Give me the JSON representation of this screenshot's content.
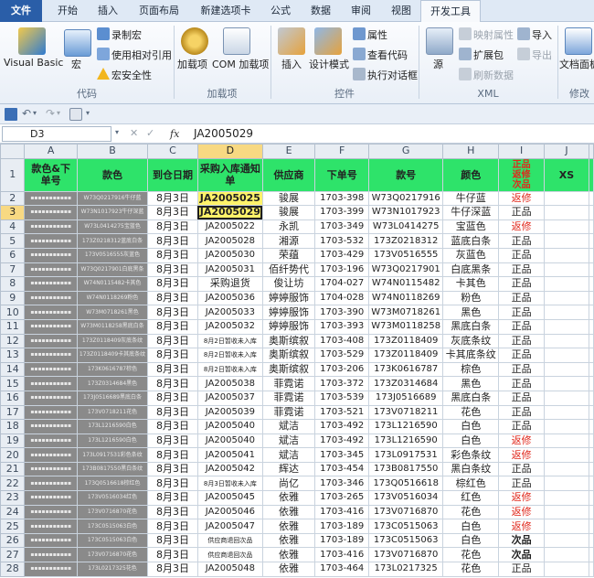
{
  "tabs": [
    "文件",
    "开始",
    "插入",
    "页面布局",
    "新建选项卡",
    "公式",
    "数据",
    "审阅",
    "视图",
    "开发工具"
  ],
  "ribbon": {
    "code": {
      "visual_basic": "Visual Basic",
      "macro": "宏",
      "record_macro": "录制宏",
      "relative_ref": "使用相对引用",
      "macro_security": "宏安全性",
      "label": "代码"
    },
    "addins": {
      "addins": "加载项",
      "com_addins": "COM 加载项",
      "label": "加载项"
    },
    "controls": {
      "insert": "插入",
      "design_mode": "设计模式",
      "properties": "属性",
      "view_code": "查看代码",
      "run_dialog": "执行对话框",
      "label": "控件"
    },
    "xml": {
      "source": "源",
      "map_props": "映射属性",
      "expansion_packs": "扩展包",
      "refresh_data": "刷新数据",
      "import": "导入",
      "export": "导出",
      "label": "XML"
    },
    "modify": {
      "doc_panel": "文档面板",
      "label": "修改"
    }
  },
  "formula_bar": {
    "name_box": "D3",
    "fx": "fx",
    "value": "JA2005029"
  },
  "colors": {
    "header_fill": "#2ee36a",
    "red_text": "#e0281c",
    "file_tab": "#2a5ea8",
    "selection_header": "#f8d982"
  },
  "sheet": {
    "columns": [
      "A",
      "B",
      "C",
      "D",
      "E",
      "F",
      "G",
      "H",
      "I",
      "J"
    ],
    "header": [
      "款色&下单号",
      "款色",
      "到仓日期",
      "采购入库通知单",
      "供应商",
      "下单号",
      "款号",
      "颜色",
      "正品 返修 次品",
      "XS"
    ],
    "rows": [
      [
        "2",
        "▪▪▪▪▪▪▪▪▪▪▪",
        "W73Q0217916牛仔蓝",
        "8月3日",
        "JA2005025",
        "骏展",
        "1703-398",
        "W73Q0217916",
        "牛仔蓝",
        "返修"
      ],
      [
        "3",
        "▪▪▪▪▪▪▪▪▪▪▪",
        "W73N1017923牛仔深蓝",
        "8月3日",
        "JA2005029",
        "骏展",
        "1703-399",
        "W73N1017923",
        "牛仔深蓝",
        "正品"
      ],
      [
        "4",
        "▪▪▪▪▪▪▪▪▪▪▪",
        "W73L0414275宝蓝色",
        "8月3日",
        "JA2005022",
        "永凯",
        "1703-349",
        "W73L0414275",
        "宝蓝色",
        "返修"
      ],
      [
        "5",
        "▪▪▪▪▪▪▪▪▪▪▪",
        "173Z0218312蓝底白条",
        "8月3日",
        "JA2005028",
        "湘源",
        "1703-532",
        "173Z0218312",
        "蓝底白条",
        "正品"
      ],
      [
        "6",
        "▪▪▪▪▪▪▪▪▪▪▪",
        "173V0516555灰蓝色",
        "8月3日",
        "JA2005030",
        "荣蕴",
        "1703-429",
        "173V0516555",
        "灰蓝色",
        "正品"
      ],
      [
        "7",
        "▪▪▪▪▪▪▪▪▪▪▪",
        "W73Q0217901白底黑条",
        "8月3日",
        "JA2005031",
        "佰纤势代",
        "1703-196",
        "W73Q0217901",
        "白底黑条",
        "正品"
      ],
      [
        "8",
        "▪▪▪▪▪▪▪▪▪▪▪",
        "W74N0115482卡其色",
        "8月3日",
        "采购退货",
        "俊让坊",
        "1704-027",
        "W74N0115482",
        "卡其色",
        "正品"
      ],
      [
        "9",
        "▪▪▪▪▪▪▪▪▪▪▪",
        "W74N0118269粉色",
        "8月3日",
        "JA2005036",
        "婷婷服饰",
        "1704-028",
        "W74N0118269",
        "粉色",
        "正品"
      ],
      [
        "10",
        "▪▪▪▪▪▪▪▪▪▪▪",
        "W73M0718261黑色",
        "8月3日",
        "JA2005033",
        "婷婷服饰",
        "1703-390",
        "W73M0718261",
        "黑色",
        "正品"
      ],
      [
        "11",
        "▪▪▪▪▪▪▪▪▪▪▪",
        "W73M0118258黑底白条",
        "8月3日",
        "JA2005032",
        "婷婷服饰",
        "1703-393",
        "W73M0118258",
        "黑底白条",
        "正品"
      ],
      [
        "12",
        "▪▪▪▪▪▪▪▪▪▪▪",
        "173Z0118409灰底条纹",
        "8月3日",
        "8月2日暂收未入库",
        "奥斯缤叙",
        "1703-408",
        "173Z0118409",
        "灰底条纹",
        "正品"
      ],
      [
        "13",
        "▪▪▪▪▪▪▪▪▪▪▪",
        "173Z0118409卡其底条纹",
        "8月3日",
        "8月2日暂收未入库",
        "奥斯缤叙",
        "1703-529",
        "173Z0118409",
        "卡其底条纹",
        "正品"
      ],
      [
        "14",
        "▪▪▪▪▪▪▪▪▪▪▪",
        "173K0616787棕色",
        "8月3日",
        "8月2日暂收未入库",
        "奥斯缤叙",
        "1703-206",
        "173K0616787",
        "棕色",
        "正品"
      ],
      [
        "15",
        "▪▪▪▪▪▪▪▪▪▪▪",
        "173Z0314684黑色",
        "8月3日",
        "JA2005038",
        "菲霓诺",
        "1703-372",
        "173Z0314684",
        "黑色",
        "正品"
      ],
      [
        "16",
        "▪▪▪▪▪▪▪▪▪▪▪",
        "173J0516689黑底白条",
        "8月3日",
        "JA2005037",
        "菲霓诺",
        "1703-539",
        "173J0516689",
        "黑底白条",
        "正品"
      ],
      [
        "17",
        "▪▪▪▪▪▪▪▪▪▪▪",
        "173V0718211花色",
        "8月3日",
        "JA2005039",
        "菲霓诺",
        "1703-521",
        "173V0718211",
        "花色",
        "正品"
      ],
      [
        "18",
        "▪▪▪▪▪▪▪▪▪▪▪",
        "173L1216590白色",
        "8月3日",
        "JA2005040",
        "斌洁",
        "1703-492",
        "173L1216590",
        "白色",
        "正品"
      ],
      [
        "19",
        "▪▪▪▪▪▪▪▪▪▪▪",
        "173L1216590白色",
        "8月3日",
        "JA2005040",
        "斌洁",
        "1703-492",
        "173L1216590",
        "白色",
        "返修"
      ],
      [
        "20",
        "▪▪▪▪▪▪▪▪▪▪▪",
        "173L0917531彩色条纹",
        "8月3日",
        "JA2005041",
        "斌洁",
        "1703-345",
        "173L0917531",
        "彩色条纹",
        "返修"
      ],
      [
        "21",
        "▪▪▪▪▪▪▪▪▪▪▪",
        "173B0817550黑白条纹",
        "8月3日",
        "JA2005042",
        "辉达",
        "1703-454",
        "173B0817550",
        "黑白条纹",
        "正品"
      ],
      [
        "22",
        "▪▪▪▪▪▪▪▪▪▪▪",
        "173Q0516618棕红色",
        "8月3日",
        "8月3日暂收未入库",
        "尚亿",
        "1703-346",
        "173Q0516618",
        "棕红色",
        "正品"
      ],
      [
        "23",
        "▪▪▪▪▪▪▪▪▪▪▪",
        "173V0516034红色",
        "8月3日",
        "JA2005045",
        "依雅",
        "1703-265",
        "173V0516034",
        "红色",
        "返修"
      ],
      [
        "24",
        "▪▪▪▪▪▪▪▪▪▪▪",
        "173V0716870花色",
        "8月3日",
        "JA2005046",
        "依雅",
        "1703-416",
        "173V0716870",
        "花色",
        "返修"
      ],
      [
        "25",
        "▪▪▪▪▪▪▪▪▪▪▪",
        "173C0515063白色",
        "8月3日",
        "JA2005047",
        "依雅",
        "1703-189",
        "173C0515063",
        "白色",
        "返修"
      ],
      [
        "26",
        "▪▪▪▪▪▪▪▪▪▪▪",
        "173C0515063白色",
        "8月3日",
        "供应商退回次品",
        "依雅",
        "1703-189",
        "173C0515063",
        "白色",
        "次品"
      ],
      [
        "27",
        "▪▪▪▪▪▪▪▪▪▪▪",
        "173V0716870花色",
        "8月3日",
        "供应商退回次品",
        "依雅",
        "1703-416",
        "173V0716870",
        "花色",
        "次品"
      ],
      [
        "28",
        "▪▪▪▪▪▪▪▪▪▪▪",
        "173L0217325花色",
        "8月3日",
        "JA2005048",
        "依雅",
        "1703-464",
        "173L0217325",
        "花色",
        "正品"
      ]
    ]
  }
}
